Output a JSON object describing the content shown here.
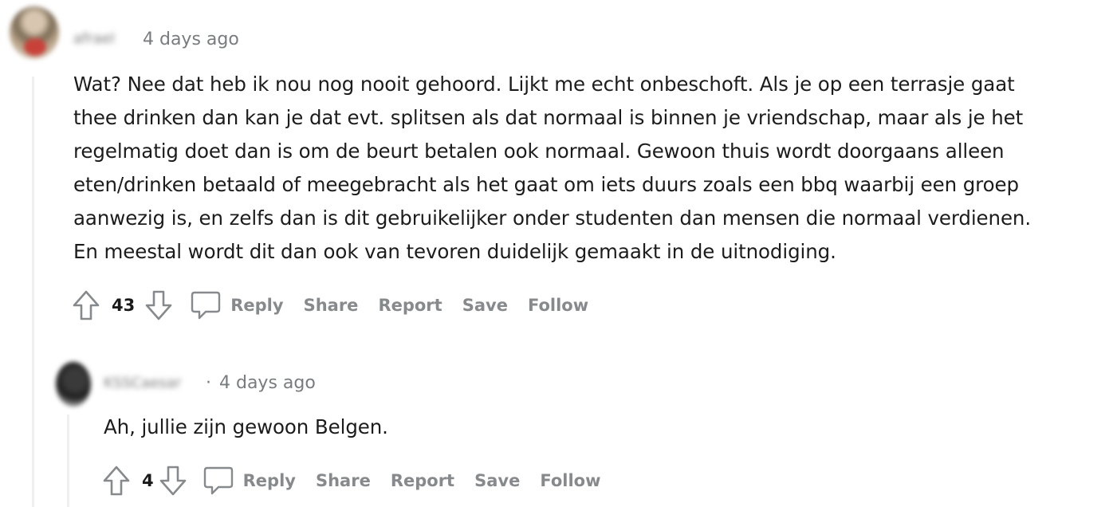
{
  "comments": [
    {
      "username": "afrael",
      "timestamp": "4 days ago",
      "body": "Wat? Nee dat heb ik nou nog nooit gehoord. Lijkt me echt onbeschoft. Als je op een terrasje gaat\nthee drinken dan kan je dat evt. splitsen als dat normaal is binnen je vriendschap, maar als je het\nregelmatig doet dan is om de beurt betalen ook normaal. Gewoon thuis wordt doorgaans alleen\neten/drinken betaald of meegebracht als het gaat om iets duurs zoals een bbq waarbij een groep\naanwezig is, en zelfs dan is dit gebruikelijker onder studenten dan mensen die normaal verdienen.\nEn meestal wordt dit dan ook van tevoren duidelijk gemaakt in de uitnodiging.",
      "votes": "43",
      "actions": {
        "reply": "Reply",
        "share": "Share",
        "report": "Report",
        "save": "Save",
        "follow": "Follow"
      }
    },
    {
      "username": "KSSCaesar",
      "separator": "·",
      "timestamp": "4 days ago",
      "body": "Ah, jullie zijn gewoon Belgen.",
      "votes": "4",
      "actions": {
        "reply": "Reply",
        "share": "Share",
        "report": "Report",
        "save": "Save",
        "follow": "Follow"
      }
    }
  ],
  "icons": {
    "upvote": "upvote-arrow-icon",
    "downvote": "downvote-arrow-icon",
    "comment": "comment-bubble-icon"
  },
  "colors": {
    "action_gray": "#878a8c",
    "meta_gray": "#787c7e",
    "thread_line": "#edeff1",
    "text": "#1c1c1c"
  }
}
